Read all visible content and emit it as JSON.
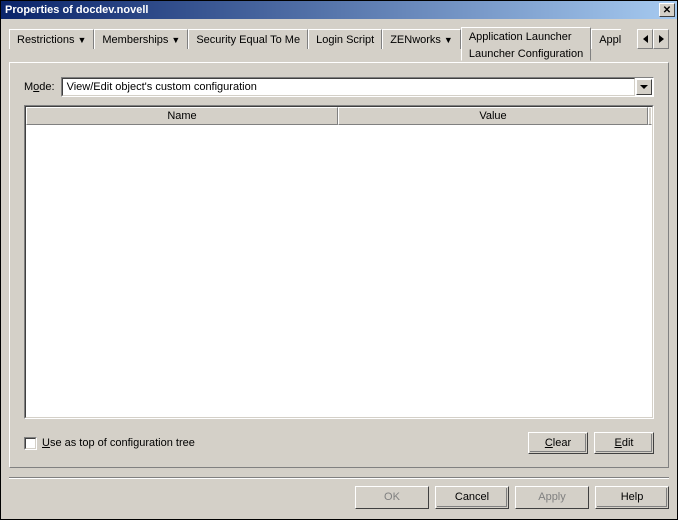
{
  "window": {
    "title": "Properties of docdev.novell"
  },
  "tabs": {
    "restrictions": "Restrictions",
    "memberships": "Memberships",
    "security_equal": "Security Equal To Me",
    "login_script": "Login Script",
    "zenworks": "ZENworks",
    "app_launcher": "Application Launcher",
    "app_launcher_sub": "Launcher Configuration",
    "applic_clip": "Applic"
  },
  "mode": {
    "label_pre": "M",
    "label_ul": "o",
    "label_post": "de:",
    "value": "View/Edit object's custom configuration"
  },
  "table": {
    "col_name": "Name",
    "col_value": "Value"
  },
  "checkbox": {
    "label_ul": "U",
    "label_post": "se as top of configuration tree"
  },
  "panel_buttons": {
    "clear_ul": "C",
    "clear_post": "lear",
    "edit_ul": "E",
    "edit_post": "dit"
  },
  "dialog_buttons": {
    "ok": "OK",
    "cancel": "Cancel",
    "apply": "Apply",
    "help": "Help"
  }
}
